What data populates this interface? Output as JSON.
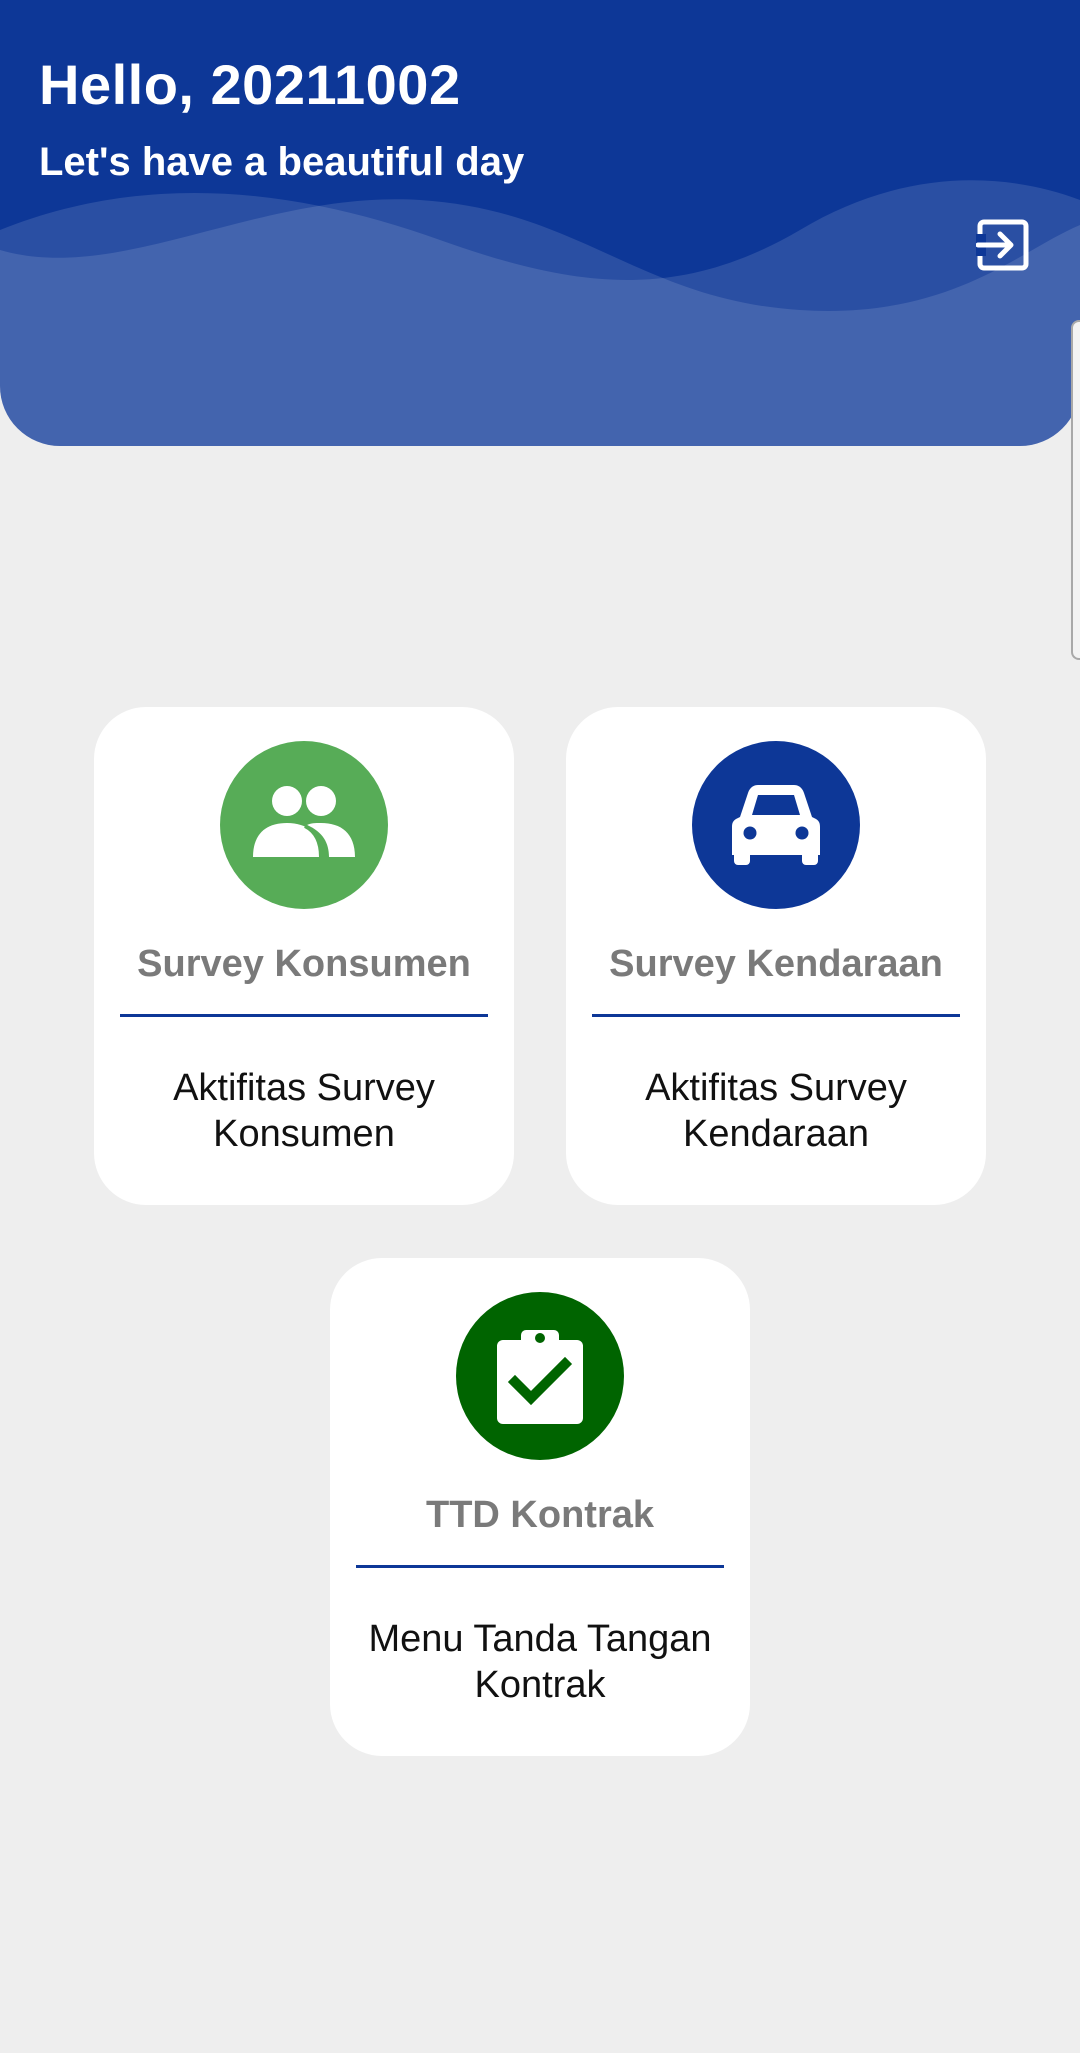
{
  "header": {
    "greeting": "Hello, 20211002",
    "tagline": "Let's have a beautiful day",
    "logout_icon": "logout-icon",
    "colors": {
      "background": "#0d3797",
      "text": "#ffffff"
    }
  },
  "menu": {
    "items": [
      {
        "title": "Survey Konsumen",
        "description": "Aktifitas Survey Konsumen",
        "icon": "people-icon",
        "icon_color": "#57ac57"
      },
      {
        "title": "Survey Kendaraan",
        "description": "Aktifitas Survey Kendaraan",
        "icon": "car-icon",
        "icon_color": "#0d3797"
      },
      {
        "title": "TTD Kontrak",
        "description": "Menu Tanda Tangan Kontrak",
        "icon": "clipboard-check-icon",
        "icon_color": "#006400"
      }
    ]
  }
}
